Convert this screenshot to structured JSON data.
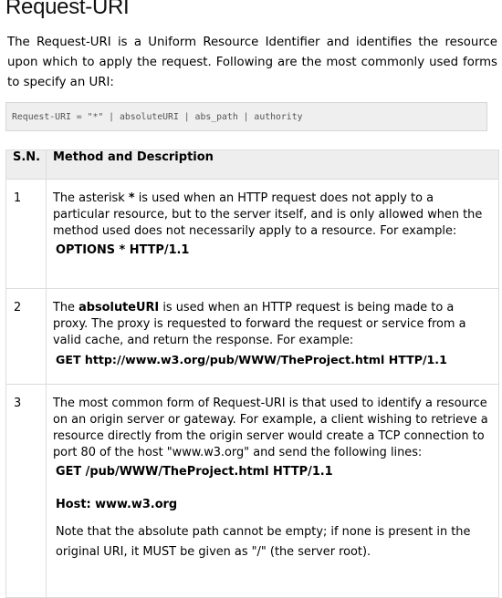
{
  "title": "Request-URI",
  "intro": "The Request-URI is a Uniform Resource Identifier and identifies the resource upon which to apply the request. Following are the most commonly used forms to specify an URI:",
  "code": "Request-URI = \"*\" | absoluteURI | abs_path | authority",
  "table": {
    "headers": {
      "sn": "S.N.",
      "desc": "Method and Description"
    },
    "rows": [
      {
        "sn": "1",
        "p1": "The asterisk ",
        "p1b": "*",
        "p1c": " is used when an HTTP request does not apply to a particular resource, but to the server itself, and is only allowed when the method used does not necessarily apply to a resource. For example:",
        "cmd": "OPTIONS * HTTP/1.1"
      },
      {
        "sn": "2",
        "p1": "The ",
        "p1b": "absoluteURI",
        "p1c": " is used when an HTTP request is being made to a proxy. The proxy is requested to forward the request or service from a valid cache, and return the response. For example:",
        "cmd": "GET http://www.w3.org/pub/WWW/TheProject.html HTTP/1.1"
      },
      {
        "sn": "3",
        "p1": "The most common form of Request-URI is that used to identify a resource on an origin server or gateway. For example, a client wishing to retrieve a resource directly from the origin server would create a TCP connection to port 80 of the host \"www.w3.org\" and send the following lines:",
        "cmd": "GET /pub/WWW/TheProject.html HTTP/1.1",
        "cmd2": "Host: www.w3.org",
        "note": "Note that the absolute path cannot be empty; if none is present in the original URI, it MUST be given as \"/\" (the server root)."
      }
    ]
  }
}
